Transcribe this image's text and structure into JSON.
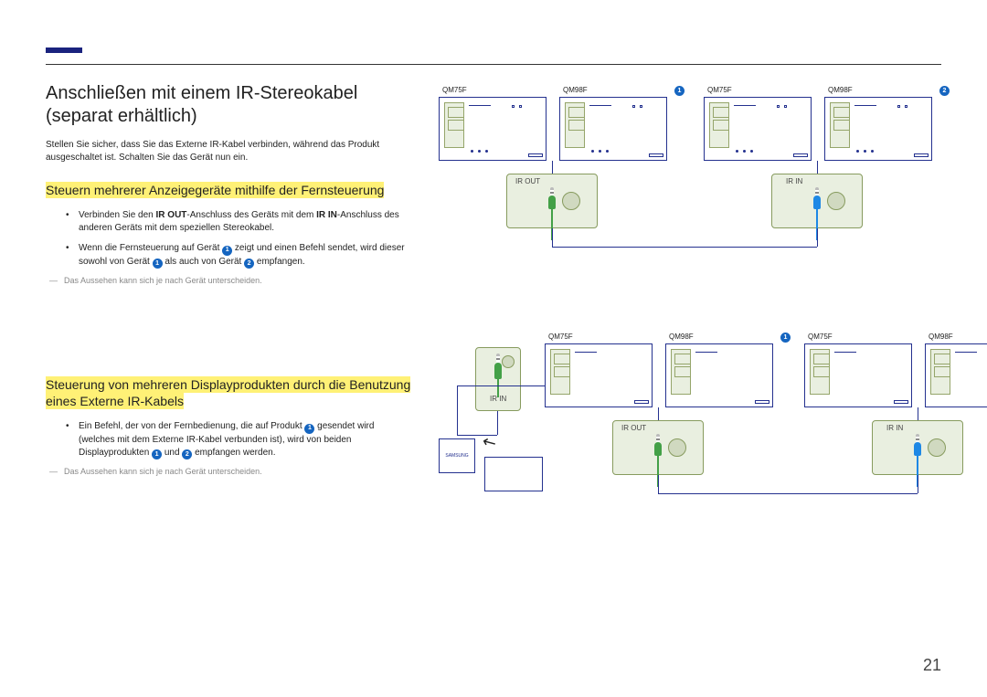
{
  "page": {
    "number": "21"
  },
  "title": "Anschließen mit einem IR-Stereokabel (separat erhältlich)",
  "intro": "Stellen Sie sicher, dass Sie das Externe IR-Kabel verbinden, während das Produkt ausgeschaltet ist. Schalten Sie das Gerät nun ein.",
  "section1": {
    "heading": "Steuern mehrerer Anzeigegeräte mithilfe der Fernsteuerung",
    "bullet1_a": "Verbinden Sie den ",
    "bullet1_bold1": "IR OUT",
    "bullet1_b": "-Anschluss des Geräts mit dem ",
    "bullet1_bold2": "IR IN",
    "bullet1_c": "-Anschluss des anderen Geräts mit dem speziellen Stereokabel.",
    "bullet2_a": "Wenn die Fernsteuerung auf Gerät ",
    "bullet2_b": " zeigt und einen Befehl sendet, wird dieser sowohl von Gerät ",
    "bullet2_c": " als auch von Gerät ",
    "bullet2_d": " empfangen.",
    "note": "Das Aussehen kann sich je nach Gerät unterscheiden."
  },
  "section2": {
    "heading": "Steuerung von mehreren Displayprodukten durch die Benutzung eines Externe IR-Kabels",
    "bullet1_a": "Ein Befehl, der von der Fernbedienung, die auf Produkt ",
    "bullet1_b": " gesendet wird (welches mit dem Externe IR-Kabel verbunden ist), wird von beiden Displayprodukten ",
    "bullet1_c": " und ",
    "bullet1_d": " empfangen werden.",
    "note": "Das Aussehen kann sich je nach Gerät unterscheiden."
  },
  "labels": {
    "model_a": "QM75F",
    "model_b": "QM98F",
    "ir_out": "IR OUT",
    "ir_in": "IR IN",
    "brand": "SAMSUNG"
  },
  "badges": {
    "one": "1",
    "two": "2"
  }
}
